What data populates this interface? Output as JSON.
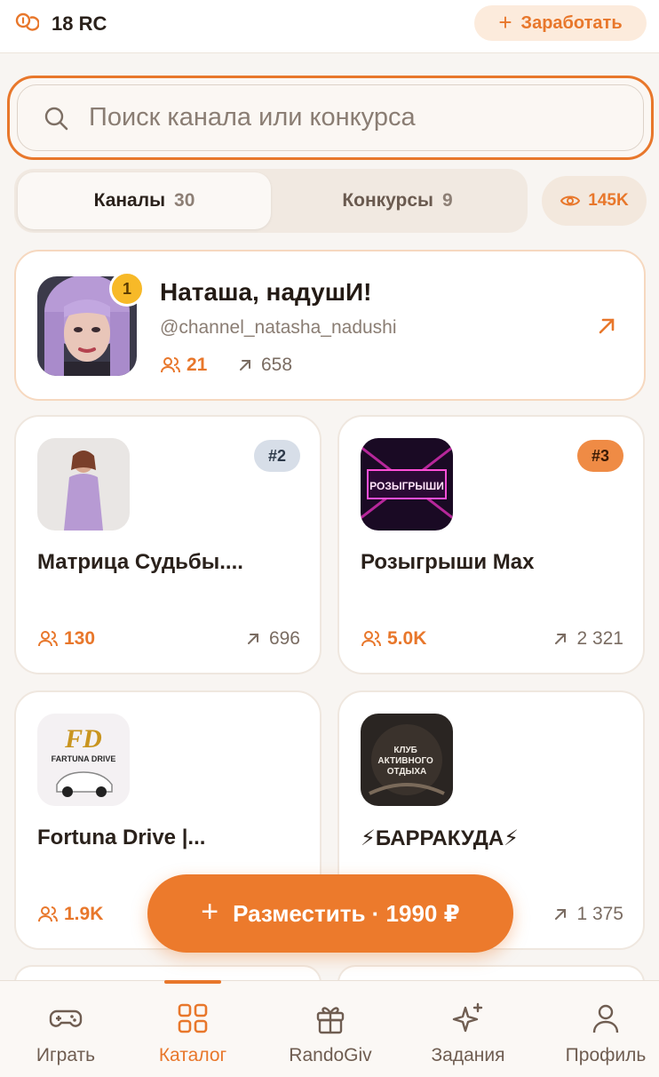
{
  "header": {
    "balance": "18 RC",
    "earn_label": "Заработать"
  },
  "search": {
    "placeholder": "Поиск канала или конкурса"
  },
  "tabs": [
    {
      "label": "Каналы",
      "count": "30",
      "active": true
    },
    {
      "label": "Конкурсы",
      "count": "9",
      "active": false
    }
  ],
  "views_count": "145K",
  "featured": {
    "rank": "1",
    "title": "Наташа, надушИ!",
    "handle": "@channel_natasha_nadushi",
    "subscribers": "21",
    "shares": "658"
  },
  "channels": [
    {
      "rank": "#2",
      "name": "Матрица Судьбы....",
      "subscribers": "130",
      "shares": "696",
      "rank_bg": "#d7dee8",
      "rank_color": "#2e3a4a"
    },
    {
      "rank": "#3",
      "name": "Розыгрыши Max",
      "subscribers": "5.0K",
      "shares": "2 321",
      "rank_bg": "#ef8b45",
      "rank_color": "#3a1a05",
      "avatar_text": "РОЗЫГРЫШИ"
    },
    {
      "rank": "",
      "name": "Fortuna Drive |...",
      "subscribers": "1.9K",
      "shares": "",
      "avatar_text": "FD",
      "avatar_sub": "FARTUNA DRIVE"
    },
    {
      "rank": "",
      "name": "⚡БАРРАКУДА⚡",
      "subscribers": "",
      "shares": "1 375",
      "avatar_text": "КЛУБ АКТИВНОГО ОТДЫХА"
    }
  ],
  "cta": {
    "label": "Разместить · 1990 ₽"
  },
  "nav": [
    {
      "label": "Играть",
      "icon": "gamepad-icon"
    },
    {
      "label": "Каталог",
      "icon": "grid-icon",
      "active": true
    },
    {
      "label": "RandoGiv",
      "icon": "gift-icon"
    },
    {
      "label": "Задания",
      "icon": "sparkles-icon"
    },
    {
      "label": "Профиль",
      "icon": "user-icon"
    }
  ],
  "colors": {
    "accent": "#e8772b",
    "background": "#f8f5f2"
  }
}
